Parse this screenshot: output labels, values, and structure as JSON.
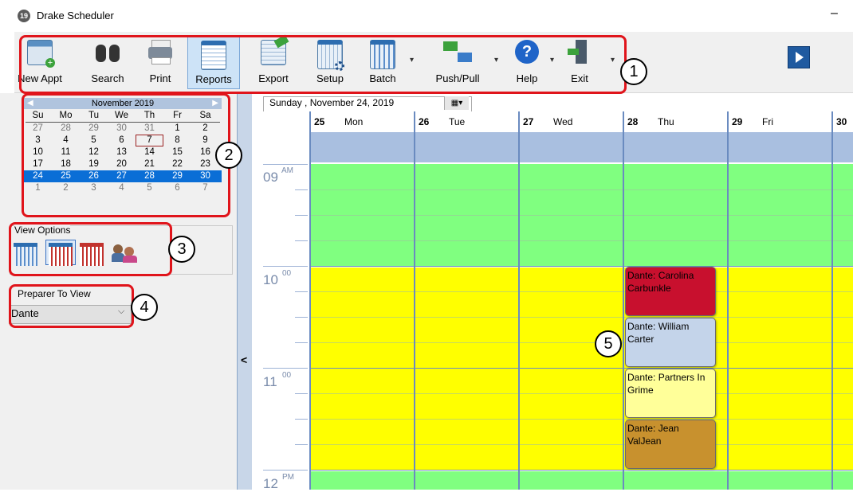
{
  "window": {
    "title": "Drake Scheduler",
    "icon_text": "19",
    "minimize": "–"
  },
  "toolbar": {
    "buttons": [
      {
        "label": "New Appt",
        "icon": "new-appointment-icon"
      },
      {
        "label": "Search",
        "icon": "binoculars-icon"
      },
      {
        "label": "Print",
        "icon": "printer-icon"
      },
      {
        "label": "Reports",
        "icon": "reports-icon"
      },
      {
        "label": "Export",
        "icon": "export-icon"
      },
      {
        "label": "Setup",
        "icon": "setup-icon"
      },
      {
        "label": "Batch",
        "icon": "batch-icon"
      },
      {
        "label": "Push/Pull",
        "icon": "push-pull-icon"
      },
      {
        "label": "Help",
        "icon": "help-icon"
      },
      {
        "label": "Exit",
        "icon": "exit-door-icon"
      }
    ]
  },
  "calendar": {
    "month": "November 2019",
    "weekdays": [
      "Su",
      "Mo",
      "Tu",
      "We",
      "Th",
      "Fr",
      "Sa"
    ],
    "weeks": [
      [
        "27",
        "28",
        "29",
        "30",
        "31",
        "1",
        "2"
      ],
      [
        "3",
        "4",
        "5",
        "6",
        "7",
        "8",
        "9"
      ],
      [
        "10",
        "11",
        "12",
        "13",
        "14",
        "15",
        "16"
      ],
      [
        "17",
        "18",
        "19",
        "20",
        "21",
        "22",
        "23"
      ],
      [
        "24",
        "25",
        "26",
        "27",
        "28",
        "29",
        "30"
      ],
      [
        "1",
        "2",
        "3",
        "4",
        "5",
        "6",
        "7"
      ]
    ]
  },
  "view_options": {
    "label": "View Options"
  },
  "preparer": {
    "label": "Preparer To View",
    "value": "Dante"
  },
  "collapse": "<",
  "schedule": {
    "date_day": "Sunday",
    "date_text": ", November 24, 2019",
    "days": [
      {
        "num": "25",
        "name": "Mon"
      },
      {
        "num": "26",
        "name": "Tue"
      },
      {
        "num": "27",
        "name": "Wed"
      },
      {
        "num": "28",
        "name": "Thu"
      },
      {
        "num": "29",
        "name": "Fri"
      },
      {
        "num": "30",
        "name": ""
      }
    ],
    "hours": [
      {
        "hour": "09",
        "sup": "AM"
      },
      {
        "hour": "10",
        "sup": "00"
      },
      {
        "hour": "11",
        "sup": "00"
      },
      {
        "hour": "12",
        "sup": "PM"
      }
    ],
    "appointments": [
      {
        "text": "Dante: Carolina Carbunkle",
        "color": "#c8102e"
      },
      {
        "text": "Dante: William Carter",
        "color": "#c4d4ea"
      },
      {
        "text": "Dante: Partners In Grime",
        "color": "#ffff99"
      },
      {
        "text": "Dante: Jean ValJean",
        "color": "#c8912e"
      }
    ]
  },
  "callouts": [
    "1",
    "2",
    "3",
    "4",
    "5"
  ],
  "colors": {
    "selected_week": "#0a6ed6",
    "morning_slot": "#80ff80",
    "midday_slot": "#ffff00",
    "annotation": "#e0141b"
  }
}
